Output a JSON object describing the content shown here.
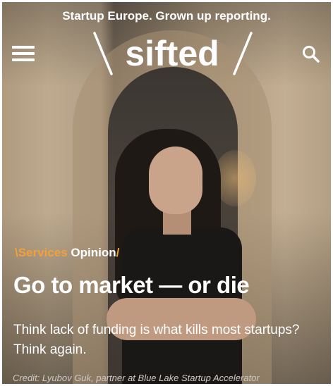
{
  "header": {
    "tagline": "Startup Europe. Grown up reporting.",
    "logo_text": "sifted",
    "menu_icon": "hamburger-menu-icon",
    "search_icon": "search-icon"
  },
  "article": {
    "category": "\\Services",
    "type": "Opinion",
    "type_suffix": "/",
    "headline": "Go to market — or die",
    "subheadline": "Think lack of funding is what kills most startups? Think again.",
    "photo_credit": "Credit: Lyubov Guk, partner at Blue Lake Startup Accelerator"
  },
  "colors": {
    "accent": "#f2a13a",
    "text": "#ffffff"
  }
}
